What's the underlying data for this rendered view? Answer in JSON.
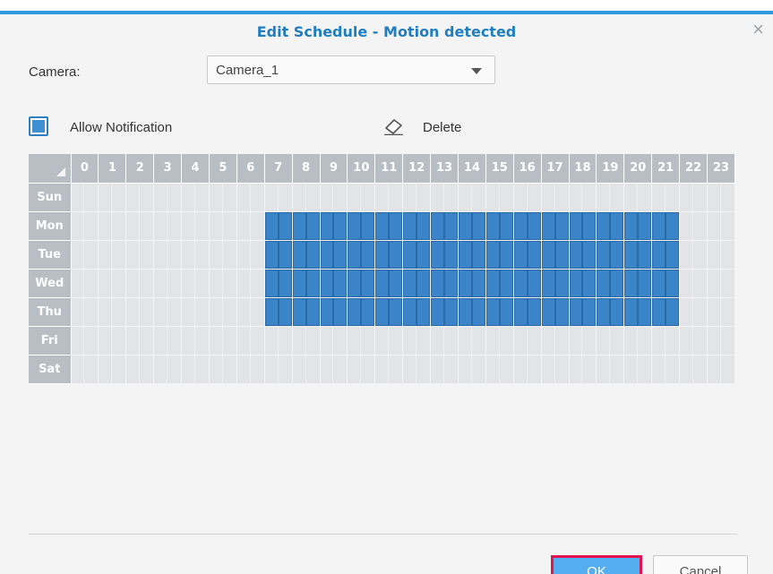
{
  "dialog": {
    "title": "Edit Schedule - Motion detected",
    "close_symbol": "×",
    "accent_color": "#2f9ae0"
  },
  "camera": {
    "label": "Camera:",
    "selected": "Camera_1"
  },
  "allow_notification": {
    "label": "Allow Notification",
    "checked": true
  },
  "delete": {
    "label": "Delete",
    "icon": "eraser-icon"
  },
  "schedule": {
    "hours": [
      "0",
      "1",
      "2",
      "3",
      "4",
      "5",
      "6",
      "7",
      "8",
      "9",
      "10",
      "11",
      "12",
      "13",
      "14",
      "15",
      "16",
      "17",
      "18",
      "19",
      "20",
      "21",
      "22",
      "23"
    ],
    "days": [
      "Sun",
      "Mon",
      "Tue",
      "Wed",
      "Thu",
      "Fri",
      "Sat"
    ],
    "active_color": "#3b84c7",
    "active": {
      "Sun": [],
      "Mon": [
        [
          7,
          22
        ]
      ],
      "Tue": [
        [
          7,
          22
        ]
      ],
      "Wed": [
        [
          7,
          22
        ]
      ],
      "Thu": [
        [
          7,
          22
        ]
      ],
      "Fri": [],
      "Sat": []
    }
  },
  "buttons": {
    "ok": "OK",
    "cancel": "Cancel"
  }
}
